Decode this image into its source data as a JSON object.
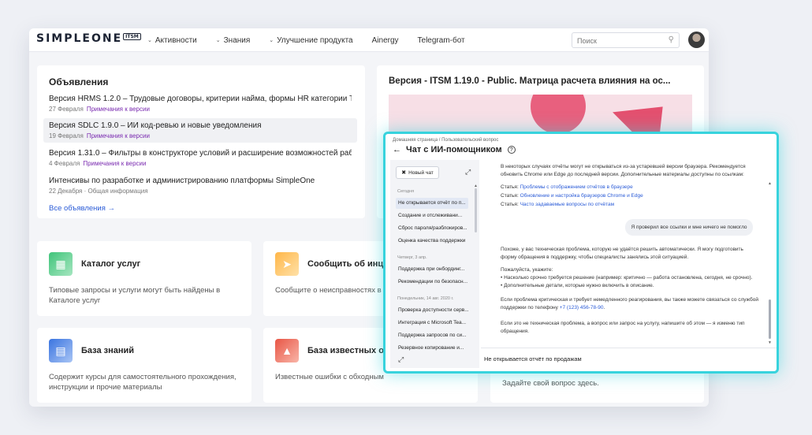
{
  "header": {
    "logo": "SIMPLEONE",
    "logo_badge": "ITSM",
    "nav": [
      {
        "label": "Активности",
        "dropdown": true
      },
      {
        "label": "Знания",
        "dropdown": true
      },
      {
        "label": "Улучшение продукта",
        "dropdown": true
      },
      {
        "label": "Ainergy",
        "dropdown": false
      },
      {
        "label": "Telegram-бот",
        "dropdown": false
      }
    ],
    "search_placeholder": "Поиск"
  },
  "announcements": {
    "title": "Объявления",
    "items": [
      {
        "title": "Версия HRMS 1.2.0 – Трудовые договоры, критерии найма, формы HR категории Тест",
        "date": "27 Февраля",
        "tag": "Примечания к версии"
      },
      {
        "title": "Версия SDLC 1.9.0 – ИИ код-ревью и новые уведомления",
        "date": "19 Февраля",
        "tag": "Примечания к версии"
      },
      {
        "title": "Версия 1.31.0 – Фильтры в конструкторе условий и расширение возможностей работ...",
        "date": "4 Февраля",
        "tag": "Примечания к версии"
      },
      {
        "title": "Интенсивы по разработке и администрированию платформы SimpleOne",
        "date": "22 Декабря",
        "tag": "Общая информация"
      }
    ],
    "all_link": "Все объявления →"
  },
  "version_card": {
    "title": "Версия - ITSM 1.19.0 - Public. Матрица расчета влияния на ос..."
  },
  "services": [
    {
      "title": "Каталог услуг",
      "desc": "Типовые запросы и услуги могут быть найдены в Каталоге услуг",
      "icon": "catalog-icon"
    },
    {
      "title": "Сообщить об инци",
      "desc": "Сообщите о неисправностях в приложений",
      "icon": "megaphone-icon"
    },
    {
      "title": "База знаний",
      "desc": "Содержит курсы для самостоятельного прохождения, инструкции и прочие материалы",
      "icon": "book-icon"
    },
    {
      "title": "База известных ош",
      "desc": "Известные ошибки с обходным",
      "icon": "known-error-icon"
    }
  ],
  "ask_card": {
    "text": "Задайте свой вопрос здесь."
  },
  "chat": {
    "breadcrumb": "Домашняя страница  /  Пользовательский вопрос",
    "title": "Чат с ИИ-помощником",
    "new_chat": "Новый чат",
    "groups": [
      {
        "label": "Сегодня",
        "items": [
          "Не открывается отчёт по п...",
          "Создание и отслеживани...",
          "Сброс пароля/разблокиров...",
          "Оценка качества поддержки"
        ]
      },
      {
        "label": "Четверг, 3 апр.",
        "items": [
          "Поддержка при онбординг...",
          "Рекомендации по безопасн..."
        ]
      },
      {
        "label": "Понедельник, 14 авг. 2020 г.",
        "items": [
          "Проверка доступности серв...",
          "Интеграция с Microsoft Tea...",
          "Поддержка запросов по си...",
          "Резервное копирование и..."
        ]
      }
    ],
    "messages": {
      "m1": "В некоторых случаях отчёты могут не открываться из-за устаревшей версии браузера. Рекомендуется обновить Chrome или Edge до последней версии. Дополнительные материалы доступны по ссылкам:",
      "article_label": "Статья:",
      "links": [
        "Проблемы с отображением отчётов в браузере",
        "Обновление и настройка браузеров Chrome и Edge",
        "Часто задаваемые вопросы по отчётам"
      ],
      "user": "Я проверил все ссылки и мне ничего не помогло",
      "r1": "Похоже, у вас техническая проблема, которую не удаётся решить автоматически. Я могу подготовить форму обращения в поддержку, чтобы специалисты занялись этой ситуацией.",
      "r2_head": "Пожалуйста, укажите:",
      "r2_b1": "• Насколько срочно требуется решение (например: критично — работа остановлена, сегодня, не срочно).",
      "r2_b2": "• Дополнительные детали, которые нужно включить в описание.",
      "r3_pre": "Если проблема критическая и требует немедленного реагирования, вы также можете связаться со службой поддержки по телефону ",
      "phone": "+7 (123) 456-78-90",
      "r3_post": ".",
      "r4": "Если это не техническая проблема, а вопрос или запрос на услугу, напишите об этом — я изменю тип обращения."
    },
    "input_value": "Не открывается отчёт по продажам"
  }
}
